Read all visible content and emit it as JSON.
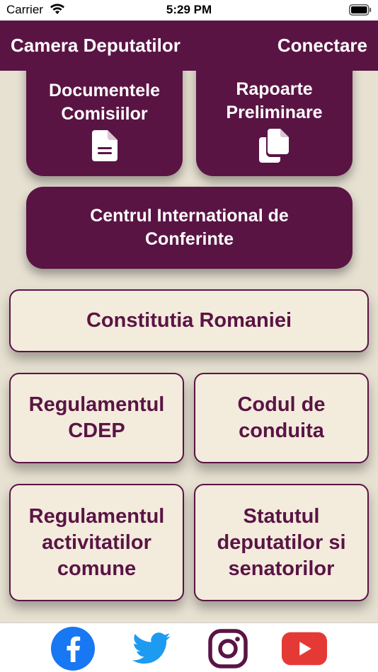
{
  "status_bar": {
    "carrier": "Carrier",
    "time": "5:29 PM"
  },
  "nav": {
    "title": "Camera Deputatilor",
    "connect": "Conectare"
  },
  "menu": {
    "documente": [
      "Documentele",
      "Comisiilor"
    ],
    "rapoarte": [
      "Rapoarte",
      "Preliminare"
    ],
    "centru": [
      "Centrul International de",
      "Conferinte"
    ],
    "constitutia": "Constitutia Romaniei",
    "regulamentul_cdep": [
      "Regulamentul",
      "CDEP"
    ],
    "codul": [
      "Codul de",
      "conduita"
    ],
    "regulamentul_act": [
      "Regulamentul",
      "activitatilor",
      "comune"
    ],
    "statutul": [
      "Statutul",
      "deputatilor si",
      "senatorilor"
    ]
  },
  "icons": {
    "documente": "document-icon",
    "rapoarte": "documents-copy-icon",
    "facebook": "facebook-icon",
    "twitter": "twitter-icon",
    "instagram": "instagram-icon",
    "youtube": "youtube-icon"
  },
  "colors": {
    "primary": "#5a1444",
    "background": "#e7e1d2",
    "light_button": "#f3ebdc",
    "facebook": "#1877f2",
    "twitter": "#1d9bf0",
    "instagram": "#5a1444",
    "youtube": "#e53935"
  }
}
